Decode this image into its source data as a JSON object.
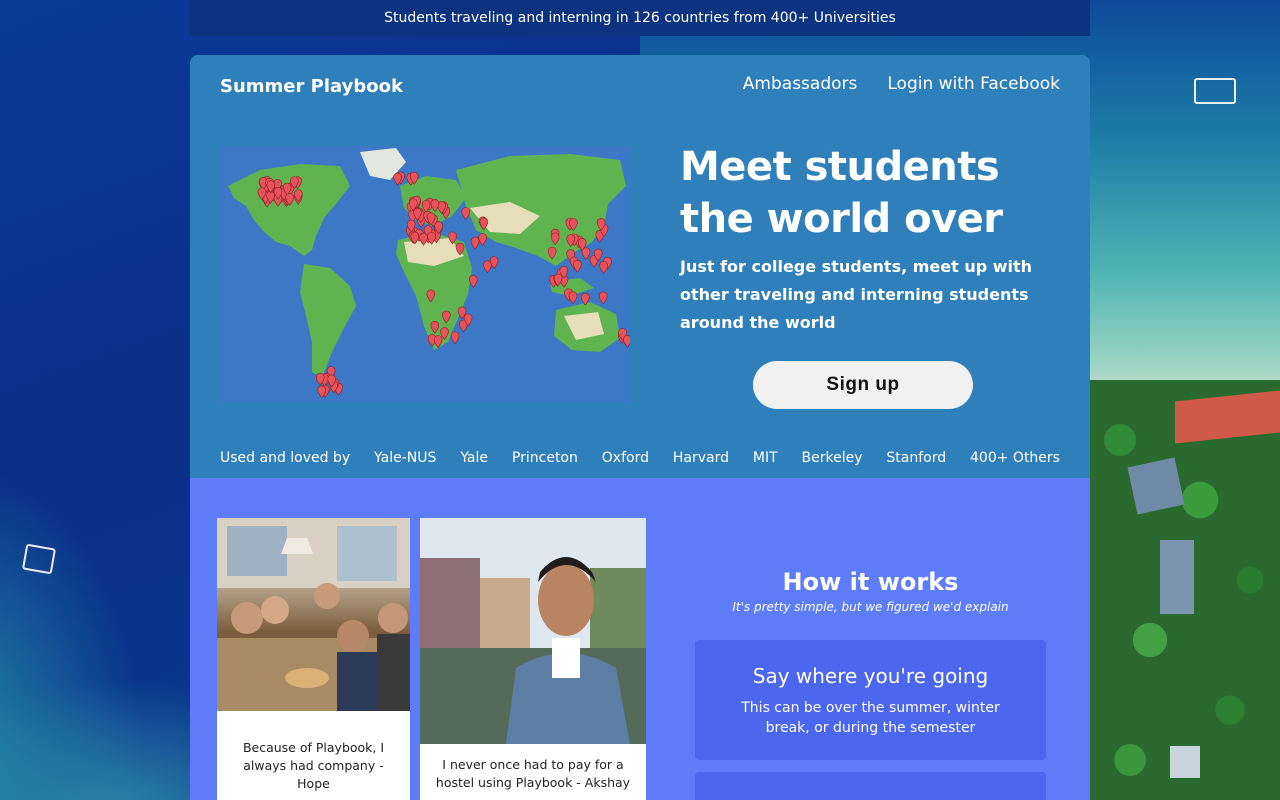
{
  "banner": {
    "text": "Students traveling and interning in 126 countries from 400+ Universities"
  },
  "header": {
    "brand": "Summer Playbook",
    "nav": {
      "ambassadors": "Ambassadors",
      "login": "Login with Facebook"
    }
  },
  "hero": {
    "title": "Meet students the world over",
    "subtitle": "Just for college students, meet up with other traveling and interning students around the world",
    "signup_label": "Sign up"
  },
  "universities": {
    "lead": "Used and loved by",
    "items": [
      "Yale-NUS",
      "Yale",
      "Princeton",
      "Oxford",
      "Harvard",
      "MIT",
      "Berkeley",
      "Stanford",
      "400+ Others"
    ]
  },
  "testimonials": [
    {
      "caption": "Because of Playbook, I always had company - Hope"
    },
    {
      "caption": "I never once had to pay for a hostel using Playbook - Akshay"
    }
  ],
  "how_it_works": {
    "title": "How it works",
    "subtitle": "It's pretty simple, but we figured we'd explain",
    "steps": [
      {
        "title": "Say where you're going",
        "description": "This can be over the summer, winter break, or during the semester"
      }
    ]
  },
  "colors": {
    "card_top": "#2f7fba",
    "card_bottom": "#5e7cf7",
    "banner": "#0b3380",
    "step_bg": "#4c66ee",
    "map_pin": "#e8525a"
  },
  "icons": {
    "map_pin": "map-pin-icon"
  }
}
